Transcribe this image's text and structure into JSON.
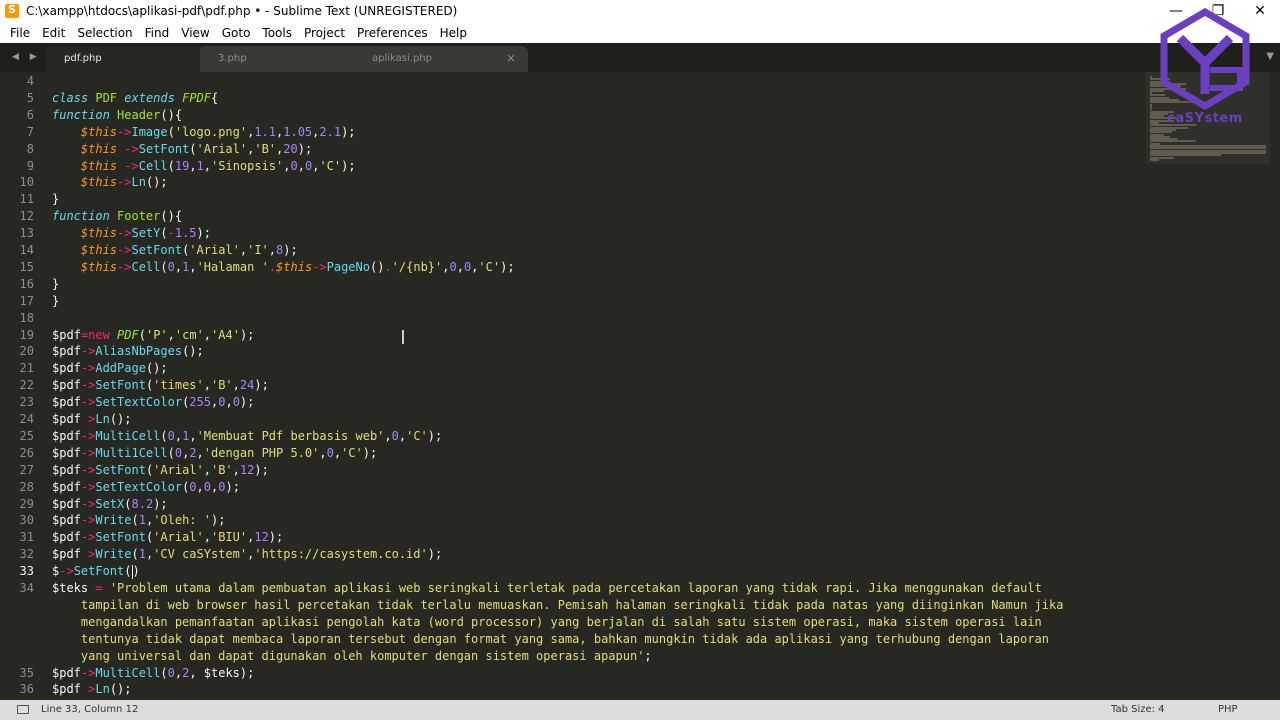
{
  "window": {
    "title": "C:\\xampp\\htdocs\\aplikasi-pdf\\pdf.php • - Sublime Text (UNREGISTERED)",
    "minimize": "—",
    "restore": "❐",
    "close": "✕"
  },
  "menu": [
    "File",
    "Edit",
    "Selection",
    "Find",
    "View",
    "Goto",
    "Tools",
    "Project",
    "Preferences",
    "Help"
  ],
  "tabs": [
    {
      "label": "pdf.php",
      "marker": "●",
      "active": true
    },
    {
      "label": "3.php",
      "marker": "×",
      "active": false
    },
    {
      "label": "aplikasi.php",
      "marker": "×",
      "active": false
    }
  ],
  "tab_nav": "◀ ▶",
  "tab_dropdown": "▼",
  "editor": {
    "current_line": 33,
    "lines": [
      {
        "n": "4",
        "html": ""
      },
      {
        "n": "5",
        "html": "<span class='c-storage'>class</span> <span class='c-class'>PDF</span> <span class='c-storage'>extends</span> <span class='c-class' style='font-style:italic'>FPDF</span>{"
      },
      {
        "n": "6",
        "html": "<span class='c-storage'>function</span> <span class='c-class'>Header</span>(){"
      },
      {
        "n": "7",
        "html": "    <span class='c-var'>$this</span><span class='c-kw'>-></span><span class='c-func'>Image</span>(<span class='c-str'>'logo.png'</span>,<span class='c-num'>1.1</span>,<span class='c-num'>1.05</span>,<span class='c-num'>2.1</span>);"
      },
      {
        "n": "8",
        "html": "    <span class='c-var'>$this</span> <span class='c-kw'>-></span><span class='c-func'>SetFont</span>(<span class='c-str'>'Arial'</span>,<span class='c-str'>'B'</span>,<span class='c-num'>20</span>);"
      },
      {
        "n": "9",
        "html": "    <span class='c-var'>$this</span> <span class='c-kw'>-></span><span class='c-func'>Cell</span>(<span class='c-num'>19</span>,<span class='c-num'>1</span>,<span class='c-str'>'Sinopsis'</span>,<span class='c-num'>0</span>,<span class='c-num'>0</span>,<span class='c-str'>'C'</span>);"
      },
      {
        "n": "10",
        "html": "    <span class='c-var'>$this</span><span class='c-kw'>-></span><span class='c-func'>Ln</span>();"
      },
      {
        "n": "11",
        "html": "}"
      },
      {
        "n": "12",
        "html": "<span class='c-storage'>function</span> <span class='c-class'>Footer</span>(){"
      },
      {
        "n": "13",
        "html": "    <span class='c-var'>$this</span><span class='c-kw'>-></span><span class='c-func'>SetY</span>(<span class='c-kw'>-</span><span class='c-num'>1.5</span>);"
      },
      {
        "n": "14",
        "html": "    <span class='c-var'>$this</span><span class='c-kw'>-></span><span class='c-func'>SetFont</span>(<span class='c-str'>'Arial'</span>,<span class='c-str'>'I'</span>,<span class='c-num'>8</span>);"
      },
      {
        "n": "15",
        "html": "    <span class='c-var'>$this</span><span class='c-kw'>-></span><span class='c-func'>Cell</span>(<span class='c-num'>0</span>,<span class='c-num'>1</span>,<span class='c-str'>'Halaman '</span><span class='c-kw'>.</span><span class='c-var'>$this</span><span class='c-kw'>-></span><span class='c-func'>PageNo</span>()<span class='c-kw'>.</span><span class='c-str'>'/{nb}'</span>,<span class='c-num'>0</span>,<span class='c-num'>0</span>,<span class='c-str'>'C'</span>);"
      },
      {
        "n": "16",
        "html": "}"
      },
      {
        "n": "17",
        "html": "}"
      },
      {
        "n": "18",
        "html": ""
      },
      {
        "n": "19",
        "html": "$pdf<span class='c-kw'>=new</span> <span class='c-class' style='font-style:italic'>PDF</span>(<span class='c-str'>'P'</span>,<span class='c-str'>'cm'</span>,<span class='c-str'>'A4'</span>);"
      },
      {
        "n": "20",
        "html": "$pdf<span class='c-kw'>-></span><span class='c-func'>AliasNbPages</span>();"
      },
      {
        "n": "21",
        "html": "$pdf<span class='c-kw'>-></span><span class='c-func'>AddPage</span>();"
      },
      {
        "n": "22",
        "html": "$pdf<span class='c-kw'>-></span><span class='c-func'>SetFont</span>(<span class='c-str'>'times'</span>,<span class='c-str'>'B'</span>,<span class='c-num'>24</span>);"
      },
      {
        "n": "23",
        "html": "$pdf<span class='c-kw'>-></span><span class='c-func'>SetTextColor</span>(<span class='c-num'>255</span>,<span class='c-num'>0</span>,<span class='c-num'>0</span>);"
      },
      {
        "n": "24",
        "html": "$pdf <span class='c-kw'>></span><span class='c-func'>Ln</span>();"
      },
      {
        "n": "25",
        "html": "$pdf<span class='c-kw'>-></span><span class='c-func'>MultiCell</span>(<span class='c-num'>0</span>,<span class='c-num'>1</span>,<span class='c-str'>'Membuat Pdf berbasis web'</span>,<span class='c-num'>0</span>,<span class='c-str'>'C'</span>);"
      },
      {
        "n": "26",
        "html": "$pdf<span class='c-kw'>-></span><span class='c-func'>Multi1Cell</span>(<span class='c-num'>0</span>,<span class='c-num'>2</span>,<span class='c-str'>'dengan PHP 5.0'</span>,<span class='c-num'>0</span>,<span class='c-str'>'C'</span>);"
      },
      {
        "n": "27",
        "html": "$pdf<span class='c-kw'>-></span><span class='c-func'>SetFont</span>(<span class='c-str'>'Arial'</span>,<span class='c-str'>'B'</span>,<span class='c-num'>12</span>);"
      },
      {
        "n": "28",
        "html": "$pdf<span class='c-kw'>-></span><span class='c-func'>SetTextColor</span>(<span class='c-num'>0</span>,<span class='c-num'>0</span>,<span class='c-num'>0</span>);"
      },
      {
        "n": "29",
        "html": "$pdf<span class='c-kw'>-></span><span class='c-func'>SetX</span>(<span class='c-num'>8.2</span>);"
      },
      {
        "n": "30",
        "html": "$pdf<span class='c-kw'>-></span><span class='c-func'>Write</span>(<span class='c-num'>1</span>,<span class='c-str'>'Oleh: '</span>);"
      },
      {
        "n": "31",
        "html": "$pdf<span class='c-kw'>-></span><span class='c-func'>SetFont</span>(<span class='c-str'>'Arial'</span>,<span class='c-str'>'BIU'</span>,<span class='c-num'>12</span>);"
      },
      {
        "n": "32",
        "html": "$pdf <span class='c-kw'>></span><span class='c-func'>Write</span>(<span class='c-num'>1</span>,<span class='c-str'>'CV caSYstem'</span>,<span class='c-str'>'https://casystem.co.id'</span>);"
      },
      {
        "n": "33",
        "html": "$<span class='c-kw'>-></span><span class='c-func'>SetFont</span>(<span class='caret'></span>)"
      },
      {
        "n": "34",
        "html": "$teks <span class='c-kw'>=</span> <span class='c-str'>'Problem utama dalam pembuatan aplikasi web seringkali terletak pada percetakan laporan yang tidak rapi. Jika menggunakan default</span>"
      },
      {
        "n": "",
        "html": "<span class='c-str'>    tampilan di web browser hasil percetakan tidak terlalu memuaskan. Pemisah halaman seringkali tidak pada natas yang diinginkan Namun jika</span>"
      },
      {
        "n": "",
        "html": "<span class='c-str'>    mengandalkan pemanfaatan aplikasi pengolah kata (word processor) yang berjalan di salah satu sistem operasi, maka sistem operasi lain</span>"
      },
      {
        "n": "",
        "html": "<span class='c-str'>    tentunya tidak dapat membaca laporan tersebut dengan format yang sama, bahkan mungkin tidak ada aplikasi yang terhubung dengan laporan</span>"
      },
      {
        "n": "",
        "html": "<span class='c-str'>    yang universal dan dapat digunakan oleh komputer dengan sistem operasi apapun'</span>;"
      },
      {
        "n": "35",
        "html": "$pdf<span class='c-kw'>-></span><span class='c-func'>MultiCell</span>(<span class='c-num'>0</span>,<span class='c-num'>2</span>, $teks);"
      },
      {
        "n": "36",
        "html": "$pdf <span class='c-kw'>></span><span class='c-func'>Ln</span>();"
      }
    ]
  },
  "logo": {
    "text": "caSYstem"
  },
  "status": {
    "position": "Line 33, Column 12",
    "tab_size": "Tab Size: 4",
    "syntax": "PHP"
  },
  "colors": {
    "background": "#272822",
    "keyword": "#f92672",
    "function": "#66d9ef",
    "string": "#e6db74",
    "number": "#ae81ff",
    "variable": "#fd971f",
    "class": "#a6e22e"
  }
}
